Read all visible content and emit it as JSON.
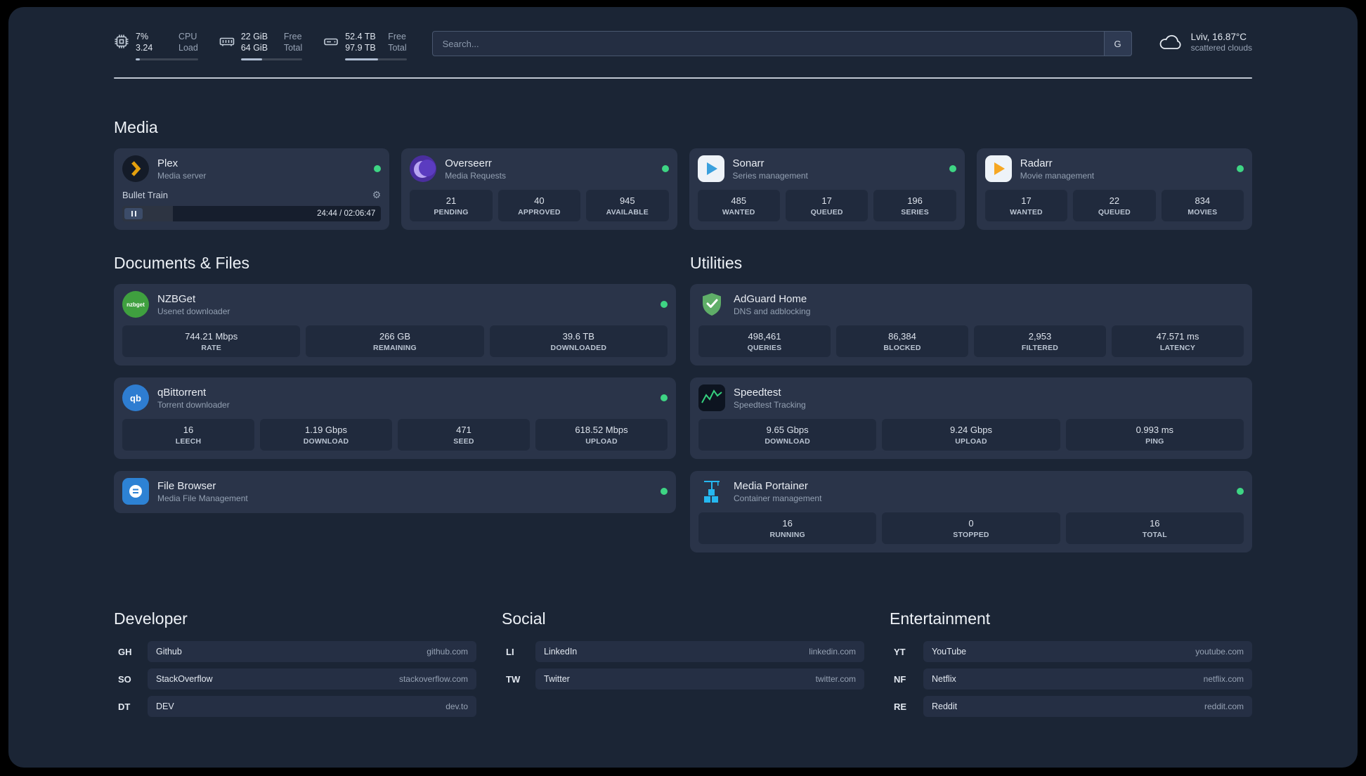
{
  "topbar": {
    "resources": [
      {
        "values": [
          "7%",
          "3.24"
        ],
        "labels": [
          "CPU",
          "Load"
        ],
        "progress": 7
      },
      {
        "values": [
          "22 GiB",
          "64 GiB"
        ],
        "labels": [
          "Free",
          "Total"
        ],
        "progress": 34
      },
      {
        "values": [
          "52.4 TB",
          "97.9 TB"
        ],
        "labels": [
          "Free",
          "Total"
        ],
        "progress": 54
      }
    ],
    "search": {
      "placeholder": "Search...",
      "provider_label": "G"
    },
    "weather": {
      "location": "Lviv, 16.87°C",
      "condition": "scattered clouds"
    }
  },
  "sections": {
    "media": {
      "title": "Media",
      "plex": {
        "name": "Plex",
        "description": "Media server",
        "now_playing": "Bullet Train",
        "time": "24:44 / 02:06:47",
        "progress": 19.5,
        "gear": "⚙"
      },
      "overseerr": {
        "name": "Overseerr",
        "description": "Media Requests",
        "stats": [
          {
            "value": "21",
            "label": "PENDING"
          },
          {
            "value": "40",
            "label": "APPROVED"
          },
          {
            "value": "945",
            "label": "AVAILABLE"
          }
        ]
      },
      "sonarr": {
        "name": "Sonarr",
        "description": "Series management",
        "stats": [
          {
            "value": "485",
            "label": "WANTED"
          },
          {
            "value": "17",
            "label": "QUEUED"
          },
          {
            "value": "196",
            "label": "SERIES"
          }
        ]
      },
      "radarr": {
        "name": "Radarr",
        "description": "Movie management",
        "stats": [
          {
            "value": "17",
            "label": "WANTED"
          },
          {
            "value": "22",
            "label": "QUEUED"
          },
          {
            "value": "834",
            "label": "MOVIES"
          }
        ]
      }
    },
    "documents": {
      "title": "Documents & Files",
      "nzbget": {
        "name": "NZBGet",
        "description": "Usenet downloader",
        "icon_text": "nzbget",
        "stats": [
          {
            "value": "744.21 Mbps",
            "label": "RATE"
          },
          {
            "value": "266 GB",
            "label": "REMAINING"
          },
          {
            "value": "39.6 TB",
            "label": "DOWNLOADED"
          }
        ]
      },
      "qbittorrent": {
        "name": "qBittorrent",
        "description": "Torrent downloader",
        "icon_text": "qb",
        "stats": [
          {
            "value": "16",
            "label": "LEECH"
          },
          {
            "value": "1.19 Gbps",
            "label": "DOWNLOAD"
          },
          {
            "value": "471",
            "label": "SEED"
          },
          {
            "value": "618.52 Mbps",
            "label": "UPLOAD"
          }
        ]
      },
      "filebrowser": {
        "name": "File Browser",
        "description": "Media File Management"
      }
    },
    "utilities": {
      "title": "Utilities",
      "adguard": {
        "name": "AdGuard Home",
        "description": "DNS and adblocking",
        "stats": [
          {
            "value": "498,461",
            "label": "QUERIES"
          },
          {
            "value": "86,384",
            "label": "BLOCKED"
          },
          {
            "value": "2,953",
            "label": "FILTERED"
          },
          {
            "value": "47.571 ms",
            "label": "LATENCY"
          }
        ]
      },
      "speedtest": {
        "name": "Speedtest",
        "description": "Speedtest Tracking",
        "stats": [
          {
            "value": "9.65 Gbps",
            "label": "DOWNLOAD"
          },
          {
            "value": "9.24 Gbps",
            "label": "UPLOAD"
          },
          {
            "value": "0.993 ms",
            "label": "PING"
          }
        ]
      },
      "portainer": {
        "name": "Media Portainer",
        "description": "Container management",
        "stats": [
          {
            "value": "16",
            "label": "RUNNING"
          },
          {
            "value": "0",
            "label": "STOPPED"
          },
          {
            "value": "16",
            "label": "TOTAL"
          }
        ]
      }
    }
  },
  "bookmarks": [
    {
      "title": "Developer",
      "items": [
        {
          "abbr": "GH",
          "label": "Github",
          "domain": "github.com"
        },
        {
          "abbr": "SO",
          "label": "StackOverflow",
          "domain": "stackoverflow.com"
        },
        {
          "abbr": "DT",
          "label": "DEV",
          "domain": "dev.to"
        }
      ]
    },
    {
      "title": "Social",
      "items": [
        {
          "abbr": "LI",
          "label": "LinkedIn",
          "domain": "linkedin.com"
        },
        {
          "abbr": "TW",
          "label": "Twitter",
          "domain": "twitter.com"
        }
      ]
    },
    {
      "title": "Entertainment",
      "items": [
        {
          "abbr": "YT",
          "label": "YouTube",
          "domain": "youtube.com"
        },
        {
          "abbr": "NF",
          "label": "Netflix",
          "domain": "netflix.com"
        },
        {
          "abbr": "RE",
          "label": "Reddit",
          "domain": "reddit.com"
        }
      ]
    }
  ],
  "colors": {
    "status_green": "#3ed584",
    "background": "#1b2535",
    "card": "#2a3449"
  }
}
